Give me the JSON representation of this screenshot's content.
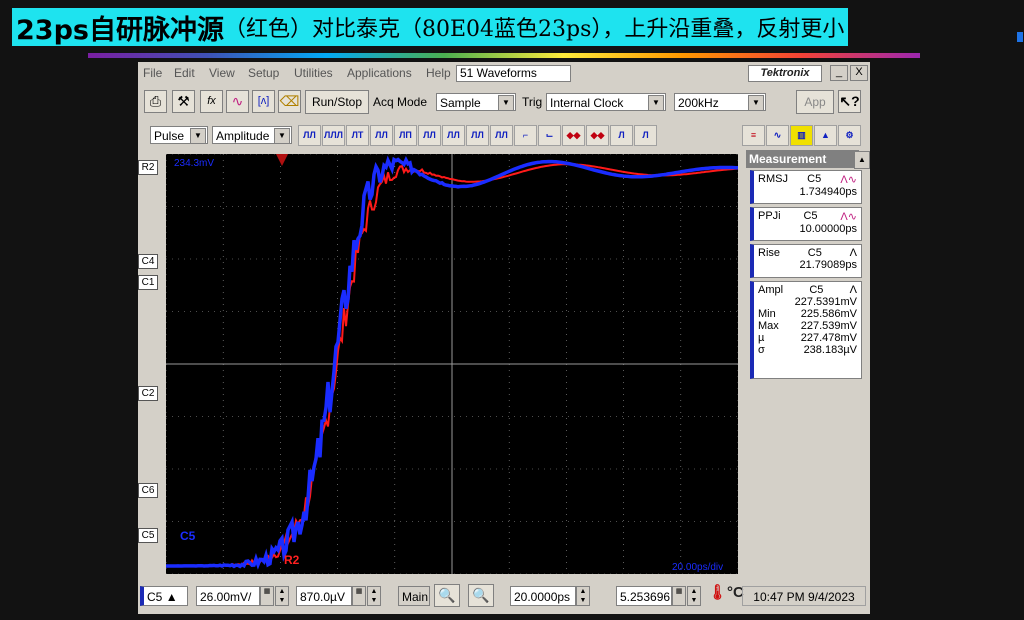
{
  "slide": {
    "title_bold": "23ps自研脉冲源",
    "title_rest": "（红色）对比泰克（80E04蓝色23ps），上升沿重叠，反射更小"
  },
  "menu": [
    "File",
    "Edit",
    "View",
    "Setup",
    "Utilities",
    "Applications",
    "Help"
  ],
  "window": {
    "waveforms": "51 Waveforms",
    "brand": "Tektronix"
  },
  "toolbar": {
    "run_stop": "Run/Stop",
    "acq_mode_label": "Acq Mode",
    "acq_mode": "Sample",
    "trig_label": "Trig",
    "trig": "Internal Clock",
    "freq": "200kHz",
    "app": "App"
  },
  "toolbar2": {
    "pulse": "Pulse",
    "amplitude": "Amplitude"
  },
  "screen": {
    "top_label": "234.3mV",
    "bottom_right": "20.00ps/div",
    "markers": [
      "R2",
      "C4",
      "C1",
      "C2",
      "C6",
      "C5"
    ],
    "trace_c5": "C5",
    "trace_r2": "R2"
  },
  "measurement": {
    "header": "Measurement",
    "items": [
      {
        "name": "RMSJ",
        "ch": "C5",
        "value": "1.734940ps"
      },
      {
        "name": "PPJi",
        "ch": "C5",
        "value": "10.00000ps"
      },
      {
        "name": "Rise",
        "ch": "C5",
        "value": "21.79089ps"
      }
    ],
    "ampl": {
      "name": "Ampl",
      "ch": "C5",
      "value": "227.5391mV",
      "stats": [
        {
          "k": "Min",
          "v": "225.586mV"
        },
        {
          "k": "Max",
          "v": "227.539mV"
        },
        {
          "k": "µ",
          "v": "227.478mV"
        },
        {
          "k": "σ",
          "v": "238.183µV"
        }
      ]
    }
  },
  "bottom": {
    "channel": "C5",
    "vdiv": "26.00mV/",
    "offset": "870.0µV",
    "main": "Main",
    "tdiv": "20.0000ps",
    "pos": "5.253696",
    "datetime": "10:47 PM 9/4/2023"
  },
  "colors": {
    "c5_trace": "#1a2cff",
    "r2_trace": "#ff1a1a",
    "title_bg": "#1ee3ef"
  }
}
